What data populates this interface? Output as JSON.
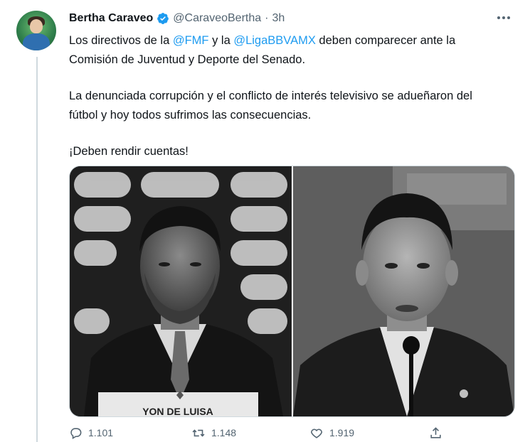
{
  "author": {
    "display_name": "Bertha Caraveo",
    "handle": "@CaraveoBertha",
    "separator": "·",
    "time": "3h",
    "verified": true
  },
  "body": {
    "p1_pre": "Los directivos de la ",
    "p1_mention1": "@FMF",
    "p1_mid": " y la ",
    "p1_mention2": "@LigaBBVAMX",
    "p1_post": " deben comparecer ante la Comisión de Juventud y Deporte del Senado.",
    "p2": "La denunciada corrupción y el conflicto de interés televisivo se adueñaron del fútbol y hoy todos sufrimos las consecuencias.",
    "p3": "¡Deben rendir cuentas!"
  },
  "media": {
    "left_nameplate": "YON DE LUISA"
  },
  "actions": {
    "replies": "1.101",
    "retweets": "1.148",
    "likes": "1.919"
  },
  "colors": {
    "accent": "#1d9bf0",
    "text": "#0f1419",
    "secondary": "#536471"
  },
  "icons": [
    "verified-badge-icon",
    "more-icon",
    "reply-icon",
    "retweet-icon",
    "like-icon",
    "share-icon"
  ]
}
